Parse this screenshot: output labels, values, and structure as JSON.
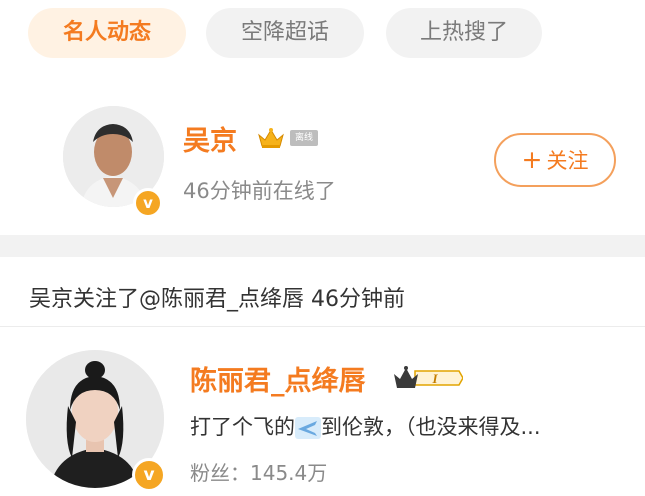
{
  "tabs": [
    "名人动态",
    "空降超话",
    "上热搜了"
  ],
  "user1": {
    "name": "吴京",
    "badge": "离线",
    "status": "46分钟前在线了",
    "follow_label": "关注",
    "follow_plus": "+",
    "verified_mark": "v"
  },
  "activity": "吴京关注了@陈丽君_点绛唇 46分钟前",
  "user2": {
    "name": "陈丽君_点绛唇",
    "level": "I",
    "post_before": "打了个飞的",
    "post_after": "到伦敦，（也没来得及...",
    "fans": "粉丝：145.4万",
    "verified_mark": "v"
  },
  "colors": {
    "accent": "#f47b20",
    "verify": "#f5a623"
  },
  "icons": [
    "crown-icon",
    "verified-icon",
    "airplane-icon",
    "vip-level-icon"
  ]
}
